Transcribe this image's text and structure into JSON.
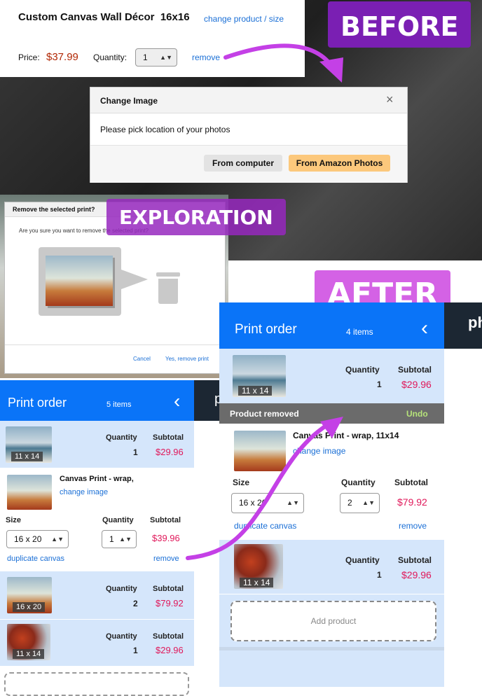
{
  "labels": {
    "before": "BEFORE",
    "exploration": "EXPLORATION",
    "after": "AFTER"
  },
  "before": {
    "product_title": "Custom Canvas Wall Décor",
    "product_size": "16x16",
    "change_link": "change product / size",
    "price_label": "Price:",
    "price": "$37.99",
    "quantity_label": "Quantity:",
    "quantity_value": "1",
    "remove_link": "remove",
    "dialog": {
      "title": "Change Image",
      "close": "×",
      "body": "Please pick location of your photos",
      "btn_computer": "From computer",
      "btn_amazon": "From Amazon Photos"
    }
  },
  "exploration": {
    "dialog_title": "Remove the selected print?",
    "dialog_body": "Are you sure you want to remove the selected print?",
    "cancel": "Cancel",
    "confirm": "Yes, remove print"
  },
  "left_panel": {
    "title": "Print order",
    "count": "5 items",
    "back": "‹",
    "side_letter": "p",
    "rows": [
      {
        "size": "11 x 14",
        "quantity_label": "Quantity",
        "quantity": "1",
        "subtotal_label": "Subtotal",
        "subtotal": "$29.96"
      },
      {
        "size": "16 x 20",
        "quantity_label": "Quantity",
        "quantity": "2",
        "subtotal_label": "Subtotal",
        "subtotal": "$79.92"
      },
      {
        "size": "11 x 14",
        "quantity_label": "Quantity",
        "quantity": "1",
        "subtotal_label": "Subtotal",
        "subtotal": "$29.96"
      }
    ],
    "expanded": {
      "name": "Canvas Print - wrap,",
      "change_image": "change image",
      "size_label": "Size",
      "size_value": "16 x 20",
      "quantity_label": "Quantity",
      "quantity_value": "1",
      "subtotal_label": "Subtotal",
      "subtotal": "$39.96",
      "duplicate": "duplicate canvas",
      "remove": "remove"
    }
  },
  "right_panel": {
    "title": "Print order",
    "count": "4 items",
    "back": "‹",
    "side_text": "ph",
    "row1": {
      "size": "11 x 14",
      "quantity_label": "Quantity",
      "quantity": "1",
      "subtotal_label": "Subtotal",
      "subtotal": "$29.96"
    },
    "removed_banner": "Product removed",
    "undo": "Undo",
    "expanded": {
      "name": "Canvas Print - wrap, 11x14",
      "change_image": "change image",
      "size_label": "Size",
      "size_value": "16 x 20",
      "quantity_label": "Quantity",
      "quantity_value": "2",
      "subtotal_label": "Subtotal",
      "subtotal": "$79.92",
      "duplicate": "duplicate canvas",
      "remove": "remove"
    },
    "row3": {
      "size": "11 x 14",
      "quantity_label": "Quantity",
      "quantity": "1",
      "subtotal_label": "Subtotal",
      "subtotal": "$29.96"
    },
    "add_product": "Add product"
  },
  "colors": {
    "accent_blue": "#0a74f8",
    "row_blue": "#d5e6fb",
    "tag_purple": "#8a2bbf",
    "arrow": "#c440e6"
  }
}
